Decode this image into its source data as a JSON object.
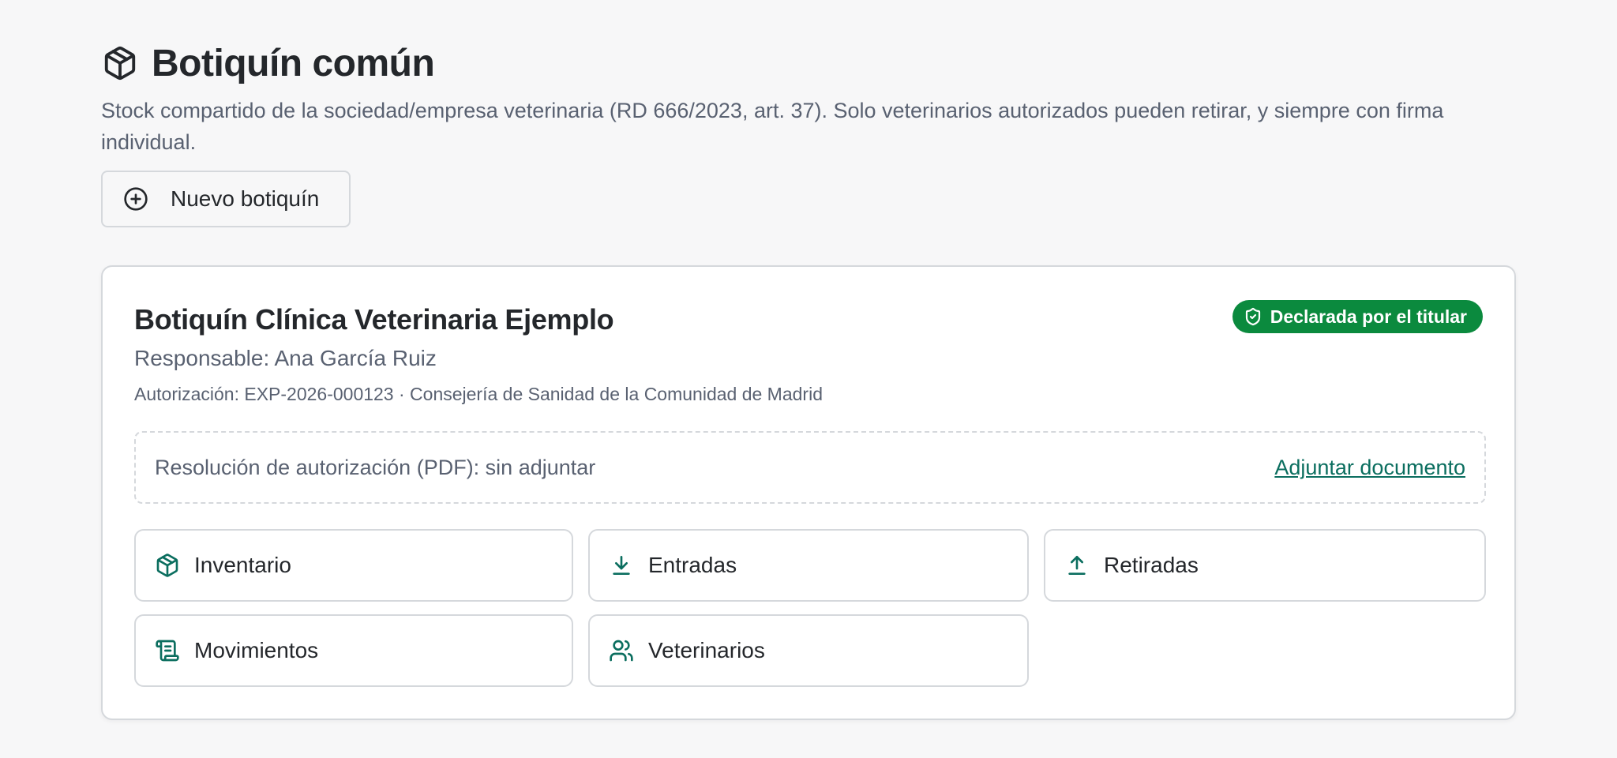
{
  "header": {
    "title": "Botiquín común",
    "description": "Stock compartido de la sociedad/empresa veterinaria (RD 666/2023, art. 37). Solo veterinarios autorizados pueden retirar, y siempre con firma individual.",
    "icon": "package-icon"
  },
  "toolbar": {
    "new_label": "Nuevo botiquín",
    "new_icon": "plus-circle-icon"
  },
  "card": {
    "title": "Botiquín Clínica Veterinaria Ejemplo",
    "responsible": "Responsable: Ana García Ruiz",
    "authorization": "Autorización: EXP-2026-000123 · Consejería de Sanidad de la Comunidad de Madrid",
    "badge": {
      "label": "Declarada por el titular",
      "icon": "shield-check-icon",
      "color": "#0b8a3e"
    },
    "document": {
      "status": "Resolución de autorización (PDF): sin adjuntar",
      "action": "Adjuntar documento"
    },
    "sections": [
      {
        "label": "Inventario",
        "icon": "package-icon"
      },
      {
        "label": "Entradas",
        "icon": "download-icon"
      },
      {
        "label": "Retiradas",
        "icon": "upload-icon"
      },
      {
        "label": "Movimientos",
        "icon": "scroll-icon"
      },
      {
        "label": "Veterinarios",
        "icon": "users-icon"
      }
    ]
  },
  "colors": {
    "accent": "#0b6e5f",
    "badge": "#0b8a3e",
    "text": "#24272b",
    "muted": "#596171",
    "border": "#d5d8dc",
    "background": "#f7f7f8"
  }
}
